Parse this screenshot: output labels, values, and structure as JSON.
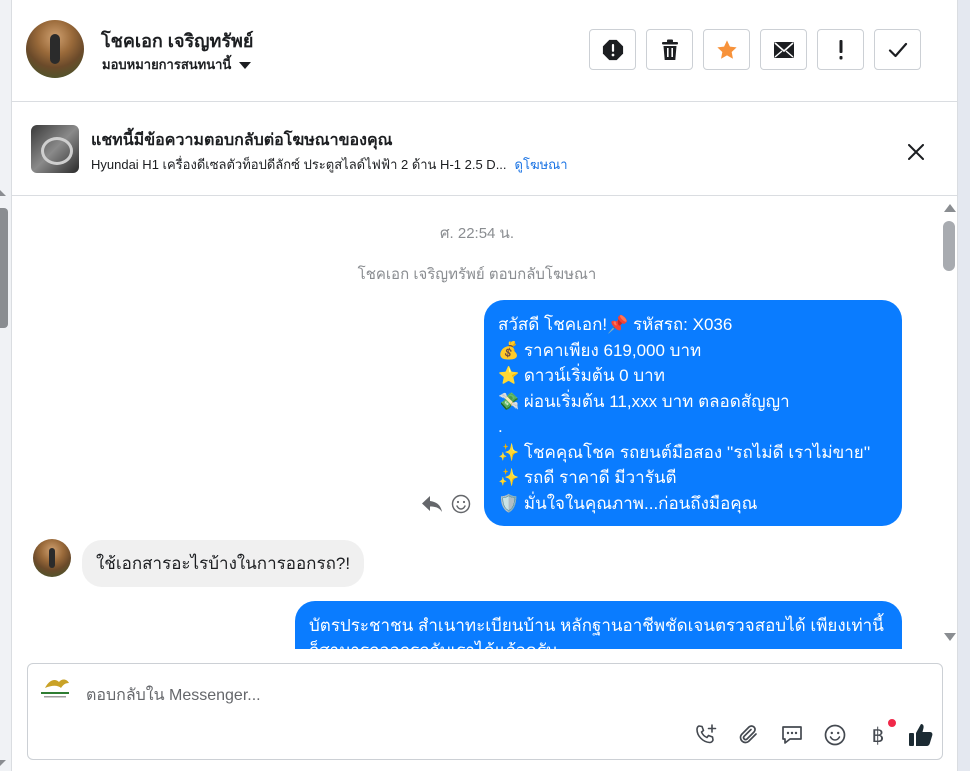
{
  "header": {
    "contact_name": "โชคเอก เจริญทรัพย์",
    "assign_label": "มอบหมายการสนทนานี้"
  },
  "actions": [
    {
      "name": "spam-button",
      "icon": "alert-octagon-icon"
    },
    {
      "name": "delete-button",
      "icon": "trash-icon"
    },
    {
      "name": "star-button",
      "icon": "star-icon"
    },
    {
      "name": "mark-unread-button",
      "icon": "envelope-icon"
    },
    {
      "name": "follow-up-button",
      "icon": "exclamation-icon"
    },
    {
      "name": "mark-done-button",
      "icon": "checkmark-icon"
    }
  ],
  "ad": {
    "title": "แชทนี้มีข้อความตอบกลับต่อโฆษณาของคุณ",
    "description": "Hyundai H1 เครื่องดีเซลตัวท็อปดีลักซ์ ประตูสไลด์ไฟฟ้า 2 ด้าน H-1 2.5 D...",
    "link": "ดูโฆษณา"
  },
  "thread": {
    "timestamp": "ศ. 22:54 น.",
    "system_note": "โชคเอก เจริญทรัพย์ ตอบกลับโฆษณา",
    "outgoing_1": [
      "สวัสดี โชคเอก!📌 รหัสรถ: X036",
      "💰 ราคาเพียง 619,000 บาท",
      "⭐ ดาวน์เริ่มต้น 0 บาท",
      "💸 ผ่อนเริ่มต้น 11,xxx บาท ตลอดสัญญา",
      ".",
      "✨ โชคคุณโชค รถยนต์มือสอง ''รถไม่ดี เราไม่ขาย''",
      "✨ รถดี ราคาดี มีวารันตี",
      "🛡️ มั่นใจในคุณภาพ...ก่อนถึงมือคุณ"
    ],
    "incoming_1": "ใช้เอกสารอะไรบ้างในการออกรถ?!",
    "outgoing_2": "บัตรประชาชน สำเนาทะเบียนบ้าน หลักฐานอาชีพชัดเจนตรวจสอบได้ เพียงเท่านี้ก็สามารถออกรถกับเราได้แล้วครับ"
  },
  "composer": {
    "placeholder": "ตอบกลับใน Messenger..."
  },
  "colors": {
    "accent": "#0a7cff",
    "link": "#1b74e4",
    "star": "#f7923a",
    "like": "#1c2b33"
  }
}
